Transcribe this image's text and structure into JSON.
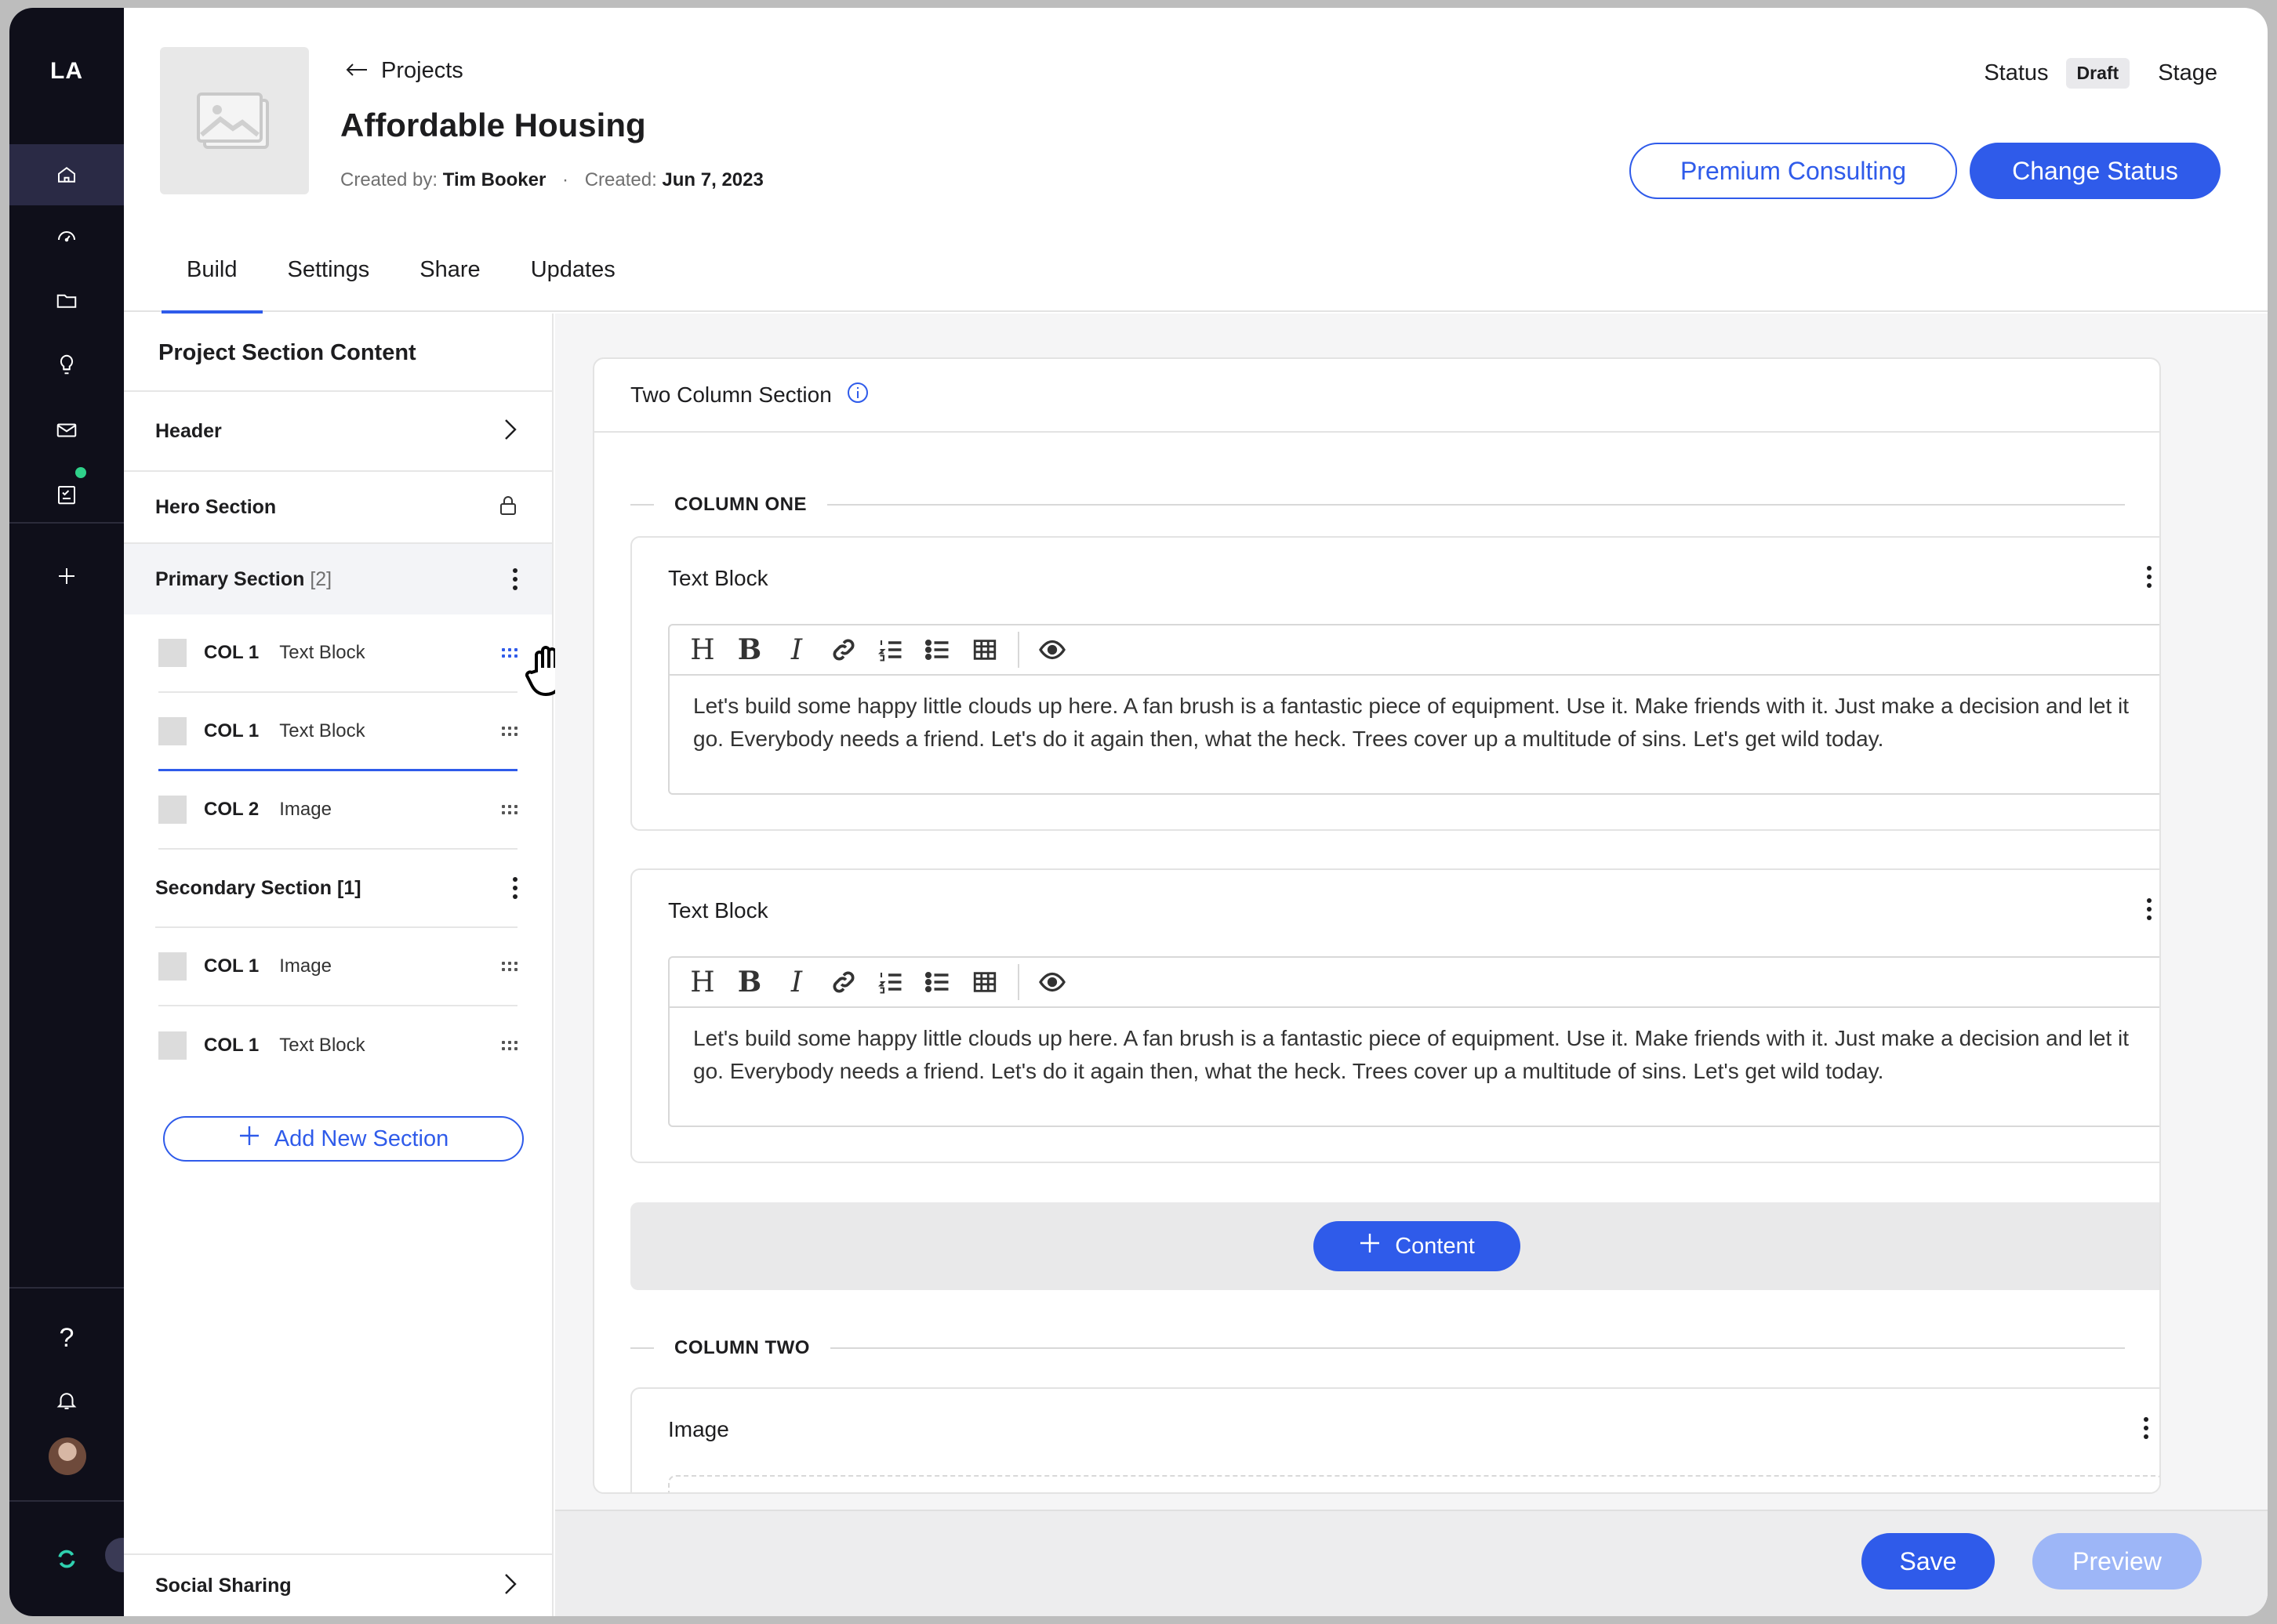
{
  "app": {
    "logo": "LA"
  },
  "rail": {
    "icons": [
      "home-icon",
      "dashboard-icon",
      "folder-icon",
      "lightbulb-icon",
      "mail-icon",
      "checklist-icon",
      "plus-icon"
    ],
    "bottom_icons": [
      "help-icon",
      "bell-icon",
      "avatar",
      "sync-icon"
    ],
    "help_glyph": "?",
    "notification_dot_color": "#2fd18a"
  },
  "header": {
    "back_label": "Projects",
    "title": "Affordable Housing",
    "created_by_label": "Created by:",
    "created_by": "Tim Booker",
    "created_label": "Created:",
    "created": "Jun 7, 2023",
    "status_label": "Status",
    "status_value": "Draft",
    "stage_label": "Stage",
    "premium_button": "Premium Consulting",
    "change_status_button": "Change Status"
  },
  "tabs": [
    {
      "label": "Build",
      "active": true
    },
    {
      "label": "Settings"
    },
    {
      "label": "Share"
    },
    {
      "label": "Updates"
    }
  ],
  "panel": {
    "title": "Project Section Content",
    "header_item": "Header",
    "hero_item": "Hero Section",
    "primary": {
      "label": "Primary Section",
      "count": "[2]"
    },
    "primary_items": [
      {
        "col": "COL 1",
        "type": "Text Block"
      },
      {
        "col": "COL 1",
        "type": "Text Block"
      },
      {
        "col": "COL 2",
        "type": "Image"
      }
    ],
    "secondary": {
      "label": "Secondary Section [1]"
    },
    "secondary_items": [
      {
        "col": "COL 1",
        "type": "Image"
      },
      {
        "col": "COL 1",
        "type": "Text Block"
      }
    ],
    "add_section": "Add New Section",
    "social": "Social Sharing"
  },
  "main": {
    "card_title": "Two Column Section",
    "column_one": "COLUMN ONE",
    "column_two": "COLUMN TWO",
    "blocks": [
      {
        "title": "Text Block",
        "text": "Let's build some happy little clouds up here. A fan brush is a fantastic piece of equipment. Use it. Make friends with it. Just make a decision and let it go. Everybody needs a friend. Let's do it again then, what the heck. Trees cover up a multitude of sins. Let's get wild today."
      },
      {
        "title": "Text Block",
        "text": "Let's build some happy little clouds up here. A fan brush is a fantastic piece of equipment. Use it. Make friends with it. Just make a decision and let it go. Everybody needs a friend. Let's do it again then, what the heck. Trees cover up a multitude of sins. Let's get wild today."
      }
    ],
    "toolbar": {
      "heading": "H",
      "bold": "B",
      "italic": "I"
    },
    "add_content": "Content",
    "image_block_title": "Image"
  },
  "footer": {
    "save": "Save",
    "preview": "Preview"
  },
  "colors": {
    "accent": "#2f5bea",
    "rail": "#0f0f1a"
  }
}
